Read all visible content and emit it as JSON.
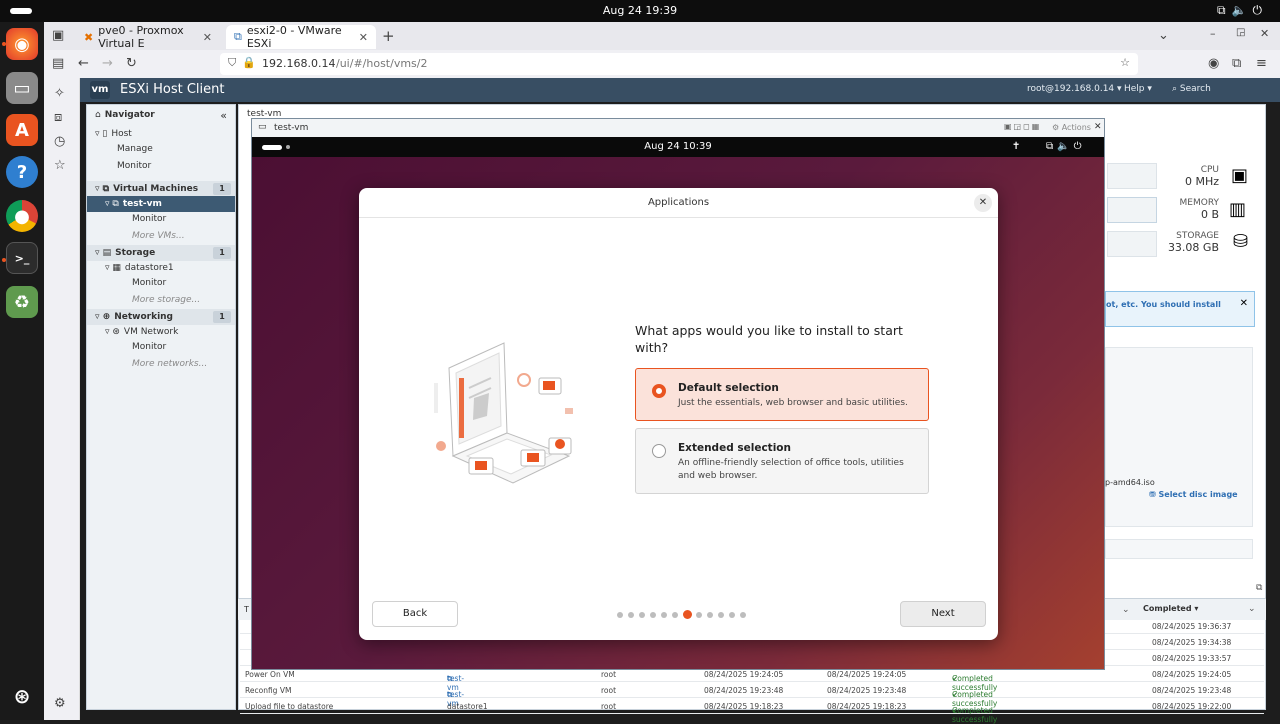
{
  "system": {
    "clock": "Aug 24  19:39"
  },
  "browser": {
    "tabs": [
      {
        "label": "pve0 - Proxmox Virtual E",
        "active": false
      },
      {
        "label": "esxi2-0 - VMware ESXi",
        "active": true
      }
    ],
    "url_host": "192.168.0.14",
    "url_path": "/ui/#/host/vms/2"
  },
  "esxi": {
    "title": "ESXi Host Client",
    "logo": "vm",
    "user": "root@192.168.0.14 ▾",
    "help": "Help ▾",
    "search": "Search",
    "navigator": {
      "title": "Navigator",
      "host": "Host",
      "manage": "Manage",
      "monitor": "Monitor",
      "virtual_machines": "Virtual Machines",
      "vm_count": "1",
      "vm_name": "test-vm",
      "more_vms": "More VMs...",
      "storage": "Storage",
      "storage_count": "1",
      "datastore": "datastore1",
      "more_storage": "More storage...",
      "networking": "Networking",
      "networking_count": "1",
      "vm_network": "VM Network",
      "more_networks": "More networks..."
    },
    "breadcrumb": "test-vm",
    "resources": {
      "cpu_label": "CPU",
      "cpu_value": "0 MHz",
      "memory_label": "MEMORY",
      "memory_value": "0 B",
      "storage_label": "STORAGE",
      "storage_value": "33.08 GB"
    },
    "notice": "ot, etc. You should install",
    "iso_fragment": "p-amd64.iso",
    "select_disc": "Select disc image",
    "tasks": {
      "completed_header": "Completed ▾",
      "rows": [
        {
          "task": "",
          "target": "",
          "initiator": "",
          "queued": "",
          "started": "",
          "result": "",
          "completed": "08/24/2025 19:36:37"
        },
        {
          "task": "",
          "target": "",
          "initiator": "",
          "queued": "",
          "started": "",
          "result": "",
          "completed": "08/24/2025 19:34:38"
        },
        {
          "task": "",
          "target": "",
          "initiator": "",
          "queued": "",
          "started": "",
          "result": "",
          "completed": "08/24/2025 19:33:57"
        },
        {
          "task": "Power On VM",
          "target": "test-vm",
          "initiator": "root",
          "queued": "08/24/2025 19:24:05",
          "started": "08/24/2025 19:24:05",
          "result": "Completed successfully",
          "completed": "08/24/2025 19:24:05"
        },
        {
          "task": "Reconfig VM",
          "target": "test-vm",
          "initiator": "root",
          "queued": "08/24/2025 19:23:48",
          "started": "08/24/2025 19:23:48",
          "result": "Completed successfully",
          "completed": "08/24/2025 19:23:48"
        },
        {
          "task": "Upload file to datastore",
          "target": "datastore1",
          "initiator": "root",
          "queued": "08/24/2025 19:18:23",
          "started": "08/24/2025 19:18:23",
          "result": "Completed successfully",
          "completed": "08/24/2025 19:22:00"
        }
      ]
    }
  },
  "console": {
    "title": "test-vm",
    "actions": "Actions",
    "guest_clock": "Aug 24  10:39"
  },
  "dialog": {
    "title": "Applications",
    "question": "What apps would you like to install to start with?",
    "options": [
      {
        "title": "Default selection",
        "desc": "Just the essentials, web browser and basic utilities.",
        "selected": true
      },
      {
        "title": "Extended selection",
        "desc": "An offline-friendly selection of office tools, utilities and web browser.",
        "selected": false
      }
    ],
    "back": "Back",
    "next": "Next",
    "steps_total": 12,
    "step_current": 7
  }
}
